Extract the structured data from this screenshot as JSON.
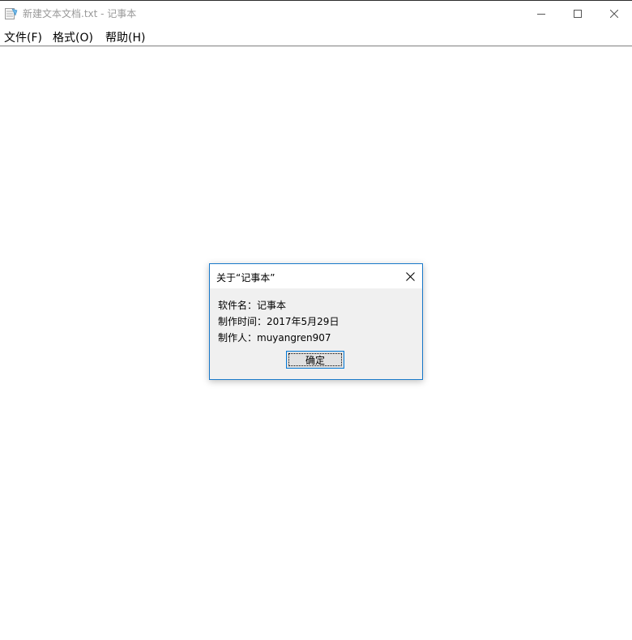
{
  "window": {
    "title": "新建文本文档.txt - 记事本",
    "icon": "notepad-icon",
    "controls": {
      "minimize_icon": "minimize-icon",
      "maximize_icon": "maximize-icon",
      "close_icon": "close-icon"
    }
  },
  "menu": {
    "items": [
      {
        "label": "文件(F)"
      },
      {
        "label": "格式(O)"
      },
      {
        "label": "帮助(H)"
      }
    ]
  },
  "editor": {
    "content": ""
  },
  "about_dialog": {
    "title": "关于“记事本”",
    "close_icon": "close-icon",
    "lines": [
      "软件名：记事本",
      "制作时间：2017年5月29日",
      "制作人：muyangren907"
    ],
    "ok_label": "确定"
  },
  "colors": {
    "dialog_border": "#1979ca",
    "dialog_body": "#f0f0f0",
    "button_focus": "#0078d7",
    "title_gray": "#999999"
  }
}
